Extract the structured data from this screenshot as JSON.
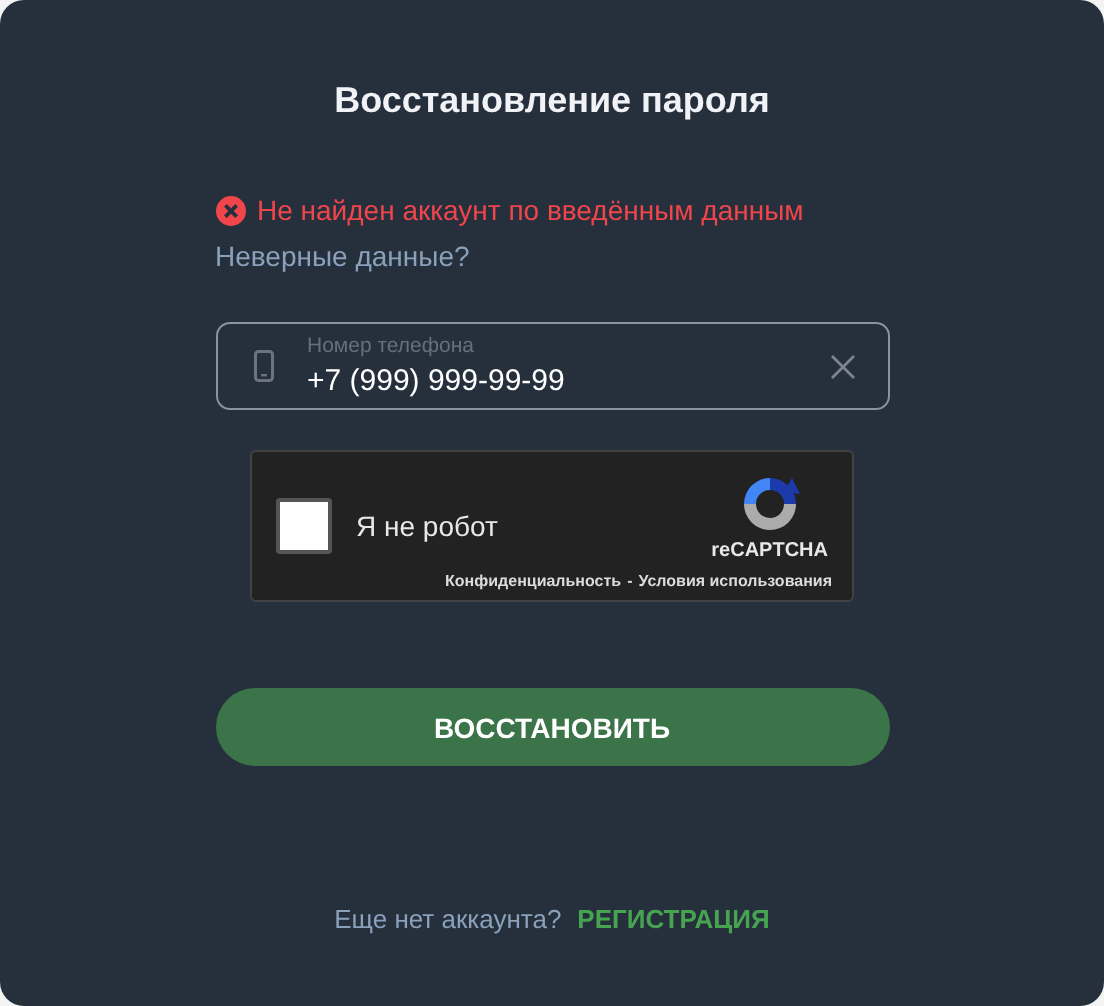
{
  "title": "Восстановление пароля",
  "error": {
    "message": "Не найден аккаунт по введённым данным"
  },
  "help_link": "Неверные данные?",
  "phone_field": {
    "label": "Номер телефона",
    "value": "+7 (999) 999-99-99"
  },
  "captcha": {
    "checked": false,
    "label": "Я не робот",
    "brand": "reCAPTCHA",
    "privacy": "Конфиденциальность",
    "separator": "-",
    "terms": "Условия использования"
  },
  "submit_button": "ВОССТАНОВИТЬ",
  "footer": {
    "question": "Еще нет аккаунта?",
    "link": "РЕГИСТРАЦИЯ"
  }
}
